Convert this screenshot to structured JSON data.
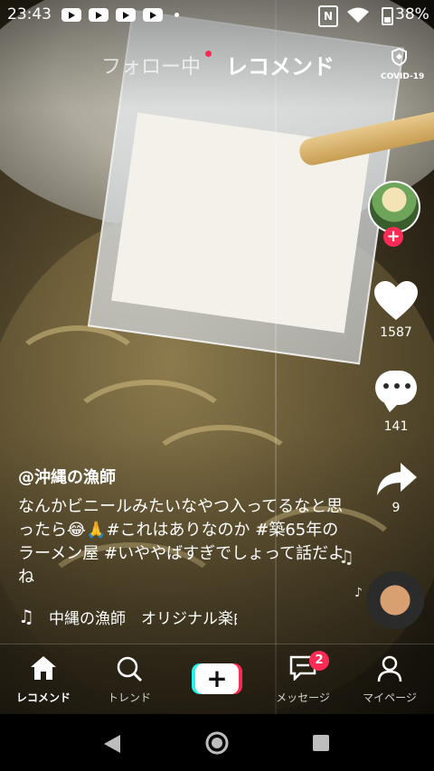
{
  "status_bar": {
    "time": "23:43",
    "notification_icons": [
      "youtube-icon",
      "youtube-icon",
      "youtube-icon",
      "youtube-icon"
    ],
    "battery_percent": "38%"
  },
  "feed_tabs": {
    "following": "フォロー中",
    "recommended": "レコメンド",
    "covid_label": "COVID-19"
  },
  "actions": {
    "likes": "1587",
    "comments": "141",
    "shares": "9"
  },
  "post": {
    "username": "@沖縄の漁師",
    "caption": "なんかビニールみたいなやつ入ってるなと思ったら😂🙏#これはありなのか #築65年のラーメン屋 #いややばすぎでしょって話だよね",
    "music": "中縄の漁師　オリジナル楽曲"
  },
  "bottom_nav": {
    "home": "レコメンド",
    "discover": "トレンド",
    "inbox": "メッセージ",
    "inbox_badge": "2",
    "profile": "マイページ"
  },
  "colors": {
    "accent_pink": "#fe2c55",
    "accent_cyan": "#25f4ee"
  }
}
